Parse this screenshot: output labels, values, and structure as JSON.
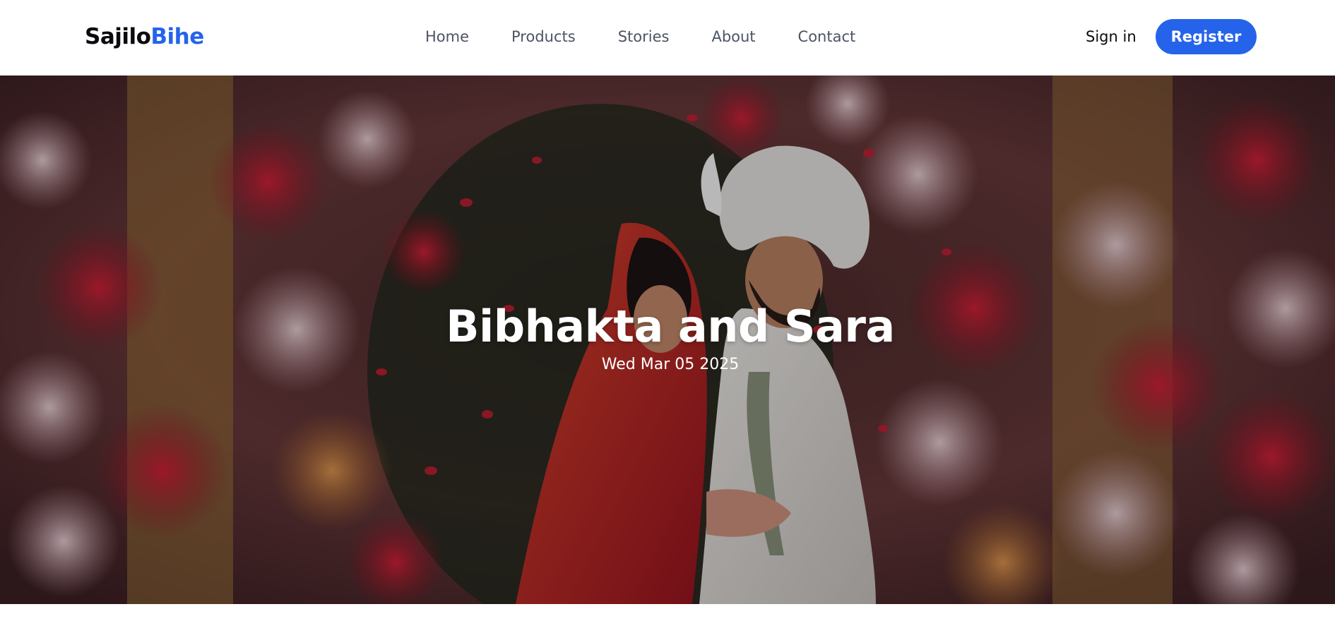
{
  "brand": {
    "part1": "Sajilo",
    "part2": "Bihe",
    "accent": "#2563eb"
  },
  "nav": {
    "links": [
      "Home",
      "Products",
      "Stories",
      "About",
      "Contact"
    ],
    "sign_in": "Sign in",
    "register": "Register"
  },
  "hero": {
    "title": "Bibhakta and Sara",
    "date": "Wed Mar 05 2025",
    "image": "wedding-couple-photo"
  }
}
